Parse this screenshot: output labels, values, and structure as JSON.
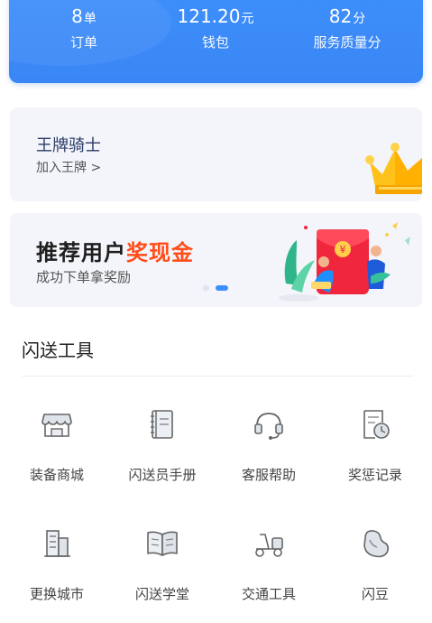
{
  "stats": [
    {
      "value": "8",
      "unit": "单",
      "label": "订单"
    },
    {
      "value": "121.20",
      "unit": "元",
      "label": "钱包"
    },
    {
      "value": "82",
      "unit": "分",
      "label": "服务质量分"
    }
  ],
  "king": {
    "title": "王牌骑士",
    "link": "加入王牌 >"
  },
  "banner": {
    "title_dark": "推荐用户",
    "title_hot": "奖现金",
    "subtitle": "成功下单拿奖励"
  },
  "tools": {
    "title": "闪送工具",
    "items": [
      {
        "label": "装备商城",
        "icon": "store-icon"
      },
      {
        "label": "闪送员手册",
        "icon": "handbook-icon"
      },
      {
        "label": "客服帮助",
        "icon": "headset-icon"
      },
      {
        "label": "奖惩记录",
        "icon": "record-icon"
      },
      {
        "label": "更换城市",
        "icon": "building-icon"
      },
      {
        "label": "闪送学堂",
        "icon": "book-icon"
      },
      {
        "label": "交通工具",
        "icon": "scooter-icon"
      },
      {
        "label": "闪豆",
        "icon": "bean-icon"
      }
    ]
  },
  "colors": {
    "primary": "#3d8ffb",
    "accent": "#ff4d1a",
    "card_bg": "#f4f5fa"
  }
}
